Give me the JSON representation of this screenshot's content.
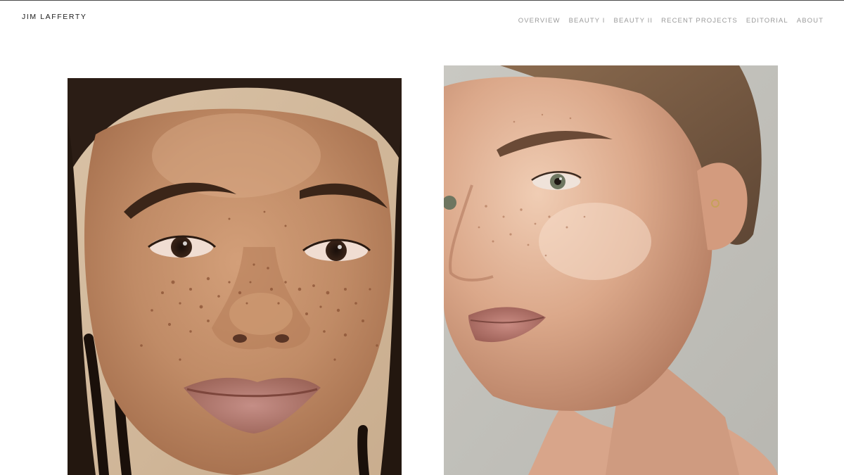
{
  "header": {
    "site_title": "JIM LAFFERTY"
  },
  "nav": {
    "items": [
      {
        "label": "OVERVIEW"
      },
      {
        "label": "BEAUTY I"
      },
      {
        "label": "BEAUTY II"
      },
      {
        "label": "RECENT PROJECTS"
      },
      {
        "label": "EDITORIAL"
      },
      {
        "label": "ABOUT"
      }
    ]
  },
  "gallery": {
    "images": [
      {
        "subject": "close-up portrait of woman with freckles and braided hair"
      },
      {
        "subject": "side-lit portrait of woman with freckles and slicked-back hair"
      }
    ]
  },
  "colors": {
    "background": "#ffffff",
    "title_text": "#1c1c1c",
    "nav_text": "#9a9a9a",
    "top_border": "#4a4a4a"
  }
}
